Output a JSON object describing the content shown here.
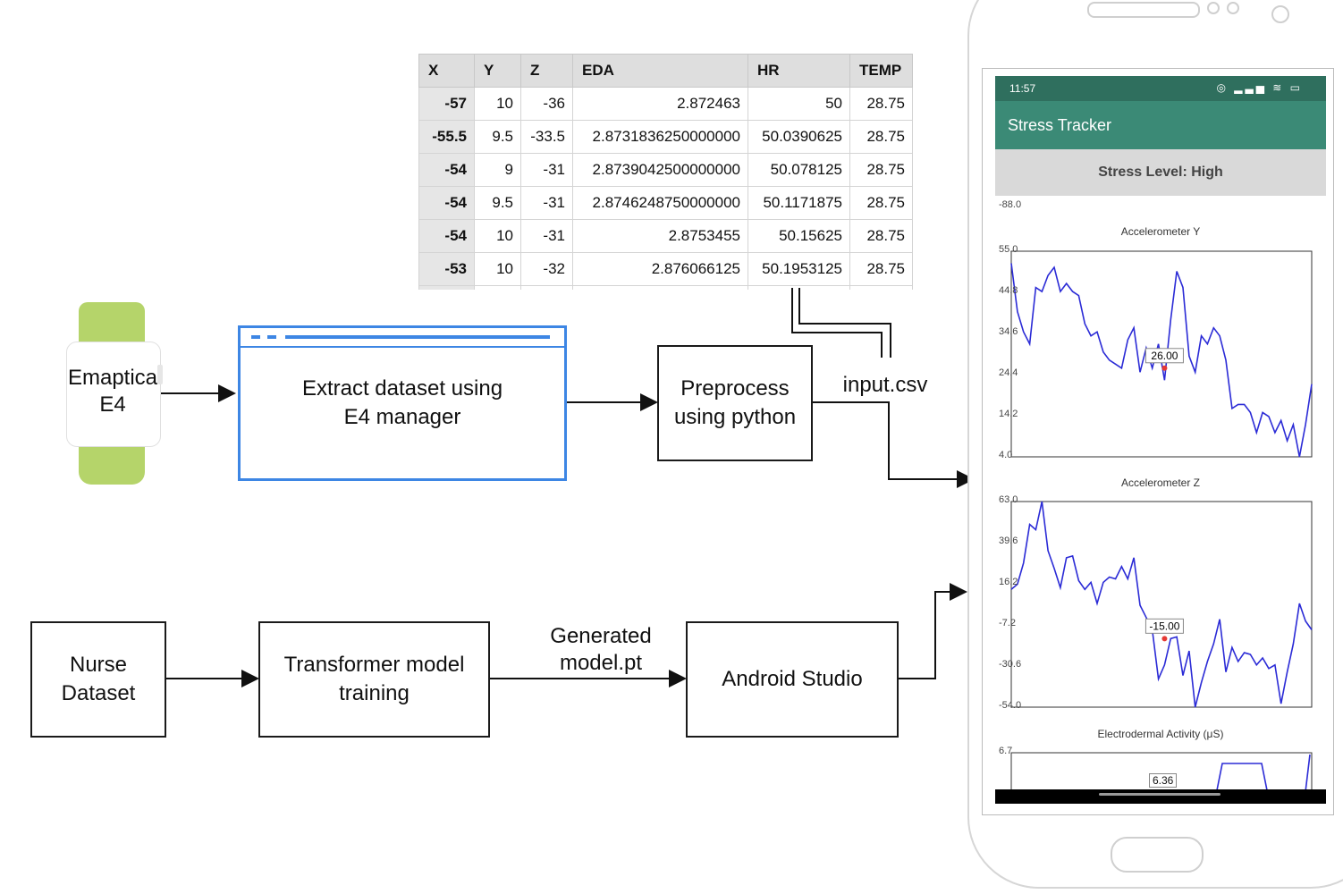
{
  "table": {
    "headers": [
      "X",
      "Y",
      "Z",
      "EDA",
      "HR",
      "TEMP"
    ],
    "rows": [
      [
        "-57",
        "10",
        "-36",
        "2.872463",
        "50",
        "28.75"
      ],
      [
        "-55.5",
        "9.5",
        "-33.5",
        "2.8731836250000000",
        "50.0390625",
        "28.75"
      ],
      [
        "-54",
        "9",
        "-31",
        "2.8739042500000000",
        "50.078125",
        "28.75"
      ],
      [
        "-54",
        "9.5",
        "-31",
        "2.8746248750000000",
        "50.1171875",
        "28.75"
      ],
      [
        "-54",
        "10",
        "-31",
        "2.8753455",
        "50.15625",
        "28.75"
      ],
      [
        "-53",
        "10",
        "-32",
        "2.876066125",
        "50.1953125",
        "28.75"
      ]
    ]
  },
  "watch": {
    "label": "Emaptica\nE4",
    "band_color": "#b5d46a"
  },
  "nodes": {
    "extract": "Extract dataset using\nE4 manager",
    "preprocess": "Preprocess\nusing python",
    "nurse": "Nurse\nDataset",
    "transformer": "Transformer model\ntraining",
    "android": "Android Studio"
  },
  "edge_labels": {
    "csv": "input.csv",
    "model": "Generated\nmodel.pt"
  },
  "phone": {
    "time": "11:57",
    "app_title": "Stress Tracker",
    "stress_level": "Stress Level: High",
    "top_residual_tick": "-88.0",
    "accent": "#3b8a76"
  },
  "chart_data": [
    {
      "type": "line",
      "title": "Accelerometer Y",
      "ylim": [
        4.0,
        55.0
      ],
      "yticks": [
        "55.0",
        "44.8",
        "34.6",
        "24.4",
        "14.2",
        "4.0"
      ],
      "values": [
        52,
        40,
        35,
        32,
        46,
        45,
        49,
        51,
        45,
        47,
        45,
        44,
        37,
        34,
        35,
        30,
        28,
        27,
        26,
        33,
        36,
        25,
        31,
        26,
        32,
        23,
        38,
        50,
        46,
        29,
        25,
        34,
        32,
        36,
        34,
        28,
        16,
        17,
        17,
        15,
        10,
        15,
        14,
        10,
        13,
        8,
        12,
        4,
        12,
        22
      ],
      "marker_label": "26.00",
      "series_color": "#2b2bd6"
    },
    {
      "type": "line",
      "title": "Accelerometer Z",
      "ylim": [
        -54.0,
        63.0
      ],
      "yticks": [
        "63.0",
        "39.6",
        "16.2",
        "-7.2",
        "-30.6",
        "-54.0"
      ],
      "values": [
        13,
        16,
        28,
        50,
        47,
        63,
        35,
        25,
        14,
        31,
        32,
        18,
        13,
        17,
        5,
        17,
        20,
        19,
        26,
        19,
        31,
        4,
        -3,
        -10,
        -38,
        -30,
        -15,
        -14,
        -36,
        -22,
        -54,
        -40,
        -28,
        -18,
        -4,
        -34,
        -20,
        -28,
        -23,
        -24,
        -30,
        -26,
        -32,
        -30,
        -52,
        -34,
        -18,
        5,
        -5,
        -10
      ],
      "marker_label": "-15.00",
      "series_color": "#2b2bd6"
    },
    {
      "type": "line",
      "title": "Electrodermal Activity (μS)",
      "yticks": [
        "6.7"
      ],
      "marker_label": "6.36",
      "series_color": "#2b2bd6"
    }
  ]
}
